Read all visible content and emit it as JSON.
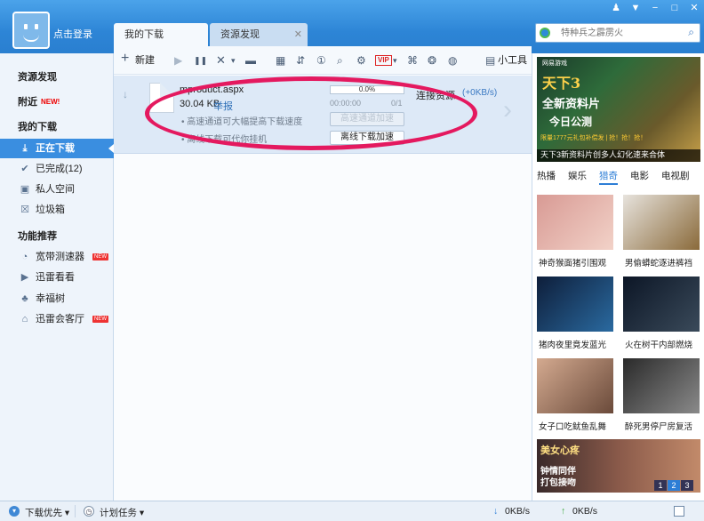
{
  "window": {
    "controls": [
      "♟",
      "▼",
      "−",
      "□",
      "✕"
    ]
  },
  "user": {
    "login_label": "点击登录"
  },
  "sidebar": {
    "section_resources": "资源发现",
    "nearby": "附近",
    "nearby_badge": "NEW!",
    "section_downloads": "我的下载",
    "items": [
      {
        "label": "正在下载",
        "icon": "download-icon",
        "glyph": "⤓"
      },
      {
        "label": "已完成(12)",
        "icon": "check-icon",
        "glyph": "✔"
      },
      {
        "label": "私人空间",
        "icon": "lock-icon",
        "glyph": "▣"
      },
      {
        "label": "垃圾箱",
        "icon": "trash-icon",
        "glyph": "☒"
      }
    ],
    "section_features": "功能推荐",
    "features": [
      {
        "label": "宽带测速器",
        "icon": "speedometer-icon",
        "glyph": "◔",
        "badge": "NEW"
      },
      {
        "label": "迅雷看看",
        "icon": "play-icon",
        "glyph": "▶",
        "badge": ""
      },
      {
        "label": "幸福树",
        "icon": "tree-icon",
        "glyph": "♣",
        "badge": ""
      },
      {
        "label": "迅雷会客厅",
        "icon": "home-icon",
        "glyph": "⌂",
        "badge": "NEW"
      }
    ]
  },
  "tabs": [
    {
      "label": "我的下载"
    },
    {
      "label": "资源发现",
      "close": "✕"
    }
  ],
  "toolbar": {
    "new_label": "新建",
    "new_glyph": "+",
    "tools_label": "小工具",
    "icons": [
      {
        "name": "start-icon",
        "glyph": "▶"
      },
      {
        "name": "pause-icon",
        "glyph": "❚❚"
      },
      {
        "name": "delete-icon",
        "glyph": "✕"
      },
      {
        "name": "dropdown-icon",
        "glyph": "▾"
      },
      {
        "name": "folder-icon",
        "glyph": "▬"
      },
      {
        "name": "grid-view-icon",
        "glyph": "▦"
      },
      {
        "name": "sort-icon",
        "glyph": "⇵"
      },
      {
        "name": "counter-icon",
        "glyph": "①"
      },
      {
        "name": "search-icon",
        "glyph": "⌕"
      },
      {
        "name": "settings-icon",
        "glyph": "⚙"
      },
      {
        "name": "vip-icon",
        "glyph": "VIP"
      },
      {
        "name": "gamepad-icon",
        "glyph": "⌘"
      },
      {
        "name": "film-icon",
        "glyph": "❂"
      },
      {
        "name": "globe-icon",
        "glyph": "◍"
      },
      {
        "name": "toolbox-icon",
        "glyph": "▤"
      }
    ]
  },
  "download": {
    "filename": "mproduct.aspx",
    "size": "30.04 KB",
    "report_label": "举报",
    "progress_text": "0.0%",
    "progress_fraction": 0.0,
    "elapsed": "00:00:00",
    "parts": "0/1",
    "tip1": "高速通道可大幅提高下载速度",
    "tip2": "离线下载可代你挂机",
    "btn_highspeed": "高速通道加速",
    "btn_offline": "离线下载加速",
    "status": "连接资源",
    "speed": "(+0KB/s)"
  },
  "search": {
    "placeholder": "特种兵之霹雳火"
  },
  "banner": {
    "publisher": "网易游戏",
    "title": "天下3",
    "line1": "全新资料片",
    "line2": "今日公测",
    "promo": "限量1777元礼包补偿发 | 抢！抢！抢！",
    "caption": "天下3新资料片创多人幻化速来合体"
  },
  "categories": [
    {
      "label": "热播",
      "active": false
    },
    {
      "label": "娱乐",
      "active": false
    },
    {
      "label": "猎奇",
      "active": true
    },
    {
      "label": "电影",
      "active": false
    },
    {
      "label": "电视剧",
      "active": false
    }
  ],
  "videos": [
    {
      "caption": "神奇猴面猪引围观",
      "color1": "#d89a94",
      "color2": "#f2d2c8"
    },
    {
      "caption": "男偷蟒蛇逐进裤裆",
      "color1": "#e7e3dd",
      "color2": "#8a6a3a"
    },
    {
      "caption": "猪肉夜里竟发蓝光",
      "color1": "#0e1e3a",
      "color2": "#2a6aa0"
    },
    {
      "caption": "火在树干内部燃烧",
      "color1": "#0c1626",
      "color2": "#3a4a5a"
    },
    {
      "caption": "女子口吃鱿鱼乱舞",
      "color1": "#d4aa90",
      "color2": "#6a4a3a"
    },
    {
      "caption": "醉死男停尸房复活",
      "color1": "#2a2a2a",
      "color2": "#8a8a8a"
    }
  ],
  "feature_video": {
    "title": "美女心疼",
    "subtitle": "钟情同伴\n打包接吻",
    "pages": [
      "1",
      "2",
      "3"
    ]
  },
  "statusbar": {
    "priority_label": "下载优先",
    "schedule_label": "计划任务",
    "down_speed": "0KB/s",
    "up_speed": "0KB/s"
  }
}
